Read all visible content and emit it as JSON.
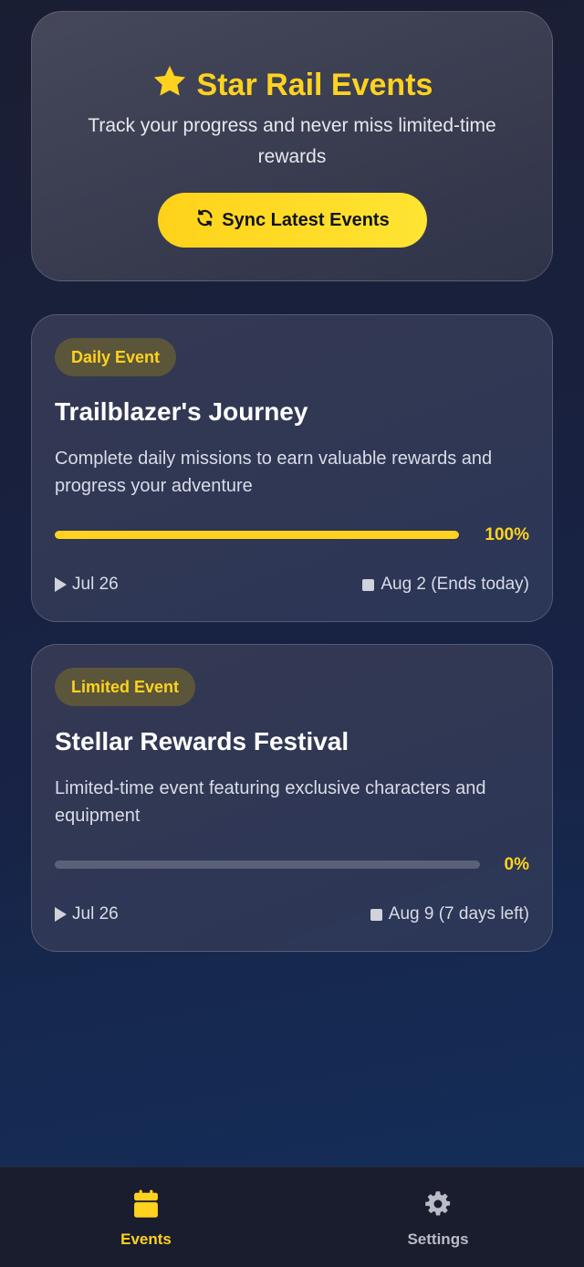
{
  "header": {
    "title": "Star Rail Events",
    "subtitle": "Track your progress and never miss limited-time rewards",
    "sync_label": "Sync Latest Events",
    "title_icon": "star-icon",
    "sync_icon": "refresh-icon"
  },
  "events": [
    {
      "badge": "Daily Event",
      "title": "Trailblazer's Journey",
      "description": "Complete daily missions to earn valuable rewards and progress your adventure",
      "progress": 1.0,
      "progress_label": "100%",
      "start": "Jul 26",
      "end": "Aug 2 (Ends today)"
    },
    {
      "badge": "Limited Event",
      "title": "Stellar Rewards Festival",
      "description": "Limited-time event featuring exclusive characters and equipment",
      "progress": 0.0,
      "progress_label": "0%",
      "start": "Jul 26",
      "end": "Aug 9 (7 days left)"
    }
  ],
  "nav": {
    "events_label": "Events",
    "settings_label": "Settings",
    "active": "events"
  },
  "colors": {
    "accent": "#ffd21f",
    "card_bg": "#363a54",
    "nav_bg": "#1a1d2e"
  }
}
